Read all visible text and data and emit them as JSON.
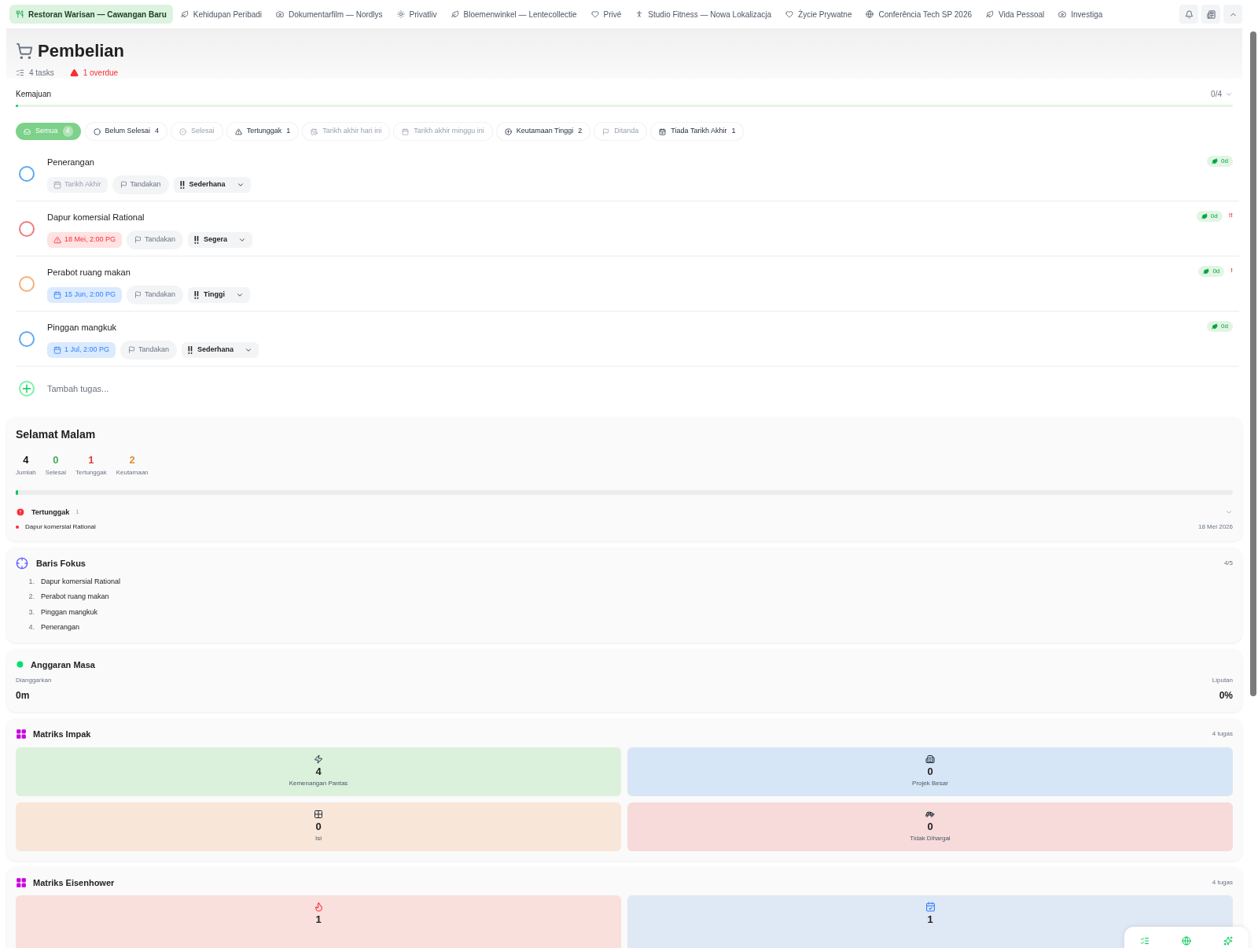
{
  "tabs": [
    {
      "label": "Restoran Warisan — Cawangan Baru",
      "selected": true
    },
    {
      "label": "Kehidupan Peribadi",
      "selected": false
    },
    {
      "label": "Dokumentarfilm — Nordlys",
      "selected": false
    },
    {
      "label": "Privatliv",
      "selected": false
    },
    {
      "label": "Bloemenwinkel — Lentecollectie",
      "selected": false
    },
    {
      "label": "Privé",
      "selected": false
    },
    {
      "label": "Studio Fitness — Nowa Lokalizacja",
      "selected": false
    },
    {
      "label": "Życie Prywatne",
      "selected": false
    },
    {
      "label": "Conferência Tech SP 2026",
      "selected": false
    },
    {
      "label": "Vida Pessoal",
      "selected": false
    },
    {
      "label": "Investiga",
      "selected": false
    }
  ],
  "header": {
    "title": "Pembelian",
    "task_count": "4 tasks",
    "overdue": "1 overdue"
  },
  "progress": {
    "label": "Kemajuan",
    "reading": "0/4",
    "level": 0
  },
  "filters": [
    {
      "label": "Semua",
      "count": "4",
      "selected": true,
      "disabled": false
    },
    {
      "label": "Belum Selesai",
      "count": "4",
      "selected": false,
      "disabled": false
    },
    {
      "label": "Selesai",
      "selected": false,
      "disabled": true
    },
    {
      "label": "Tertunggak",
      "count": "1",
      "selected": false,
      "disabled": false
    },
    {
      "label": "Tarikh akhir hari ini",
      "selected": false,
      "disabled": true
    },
    {
      "label": "Tarikh akhir minggu ini",
      "selected": false,
      "disabled": true
    },
    {
      "label": "Keutamaan Tinggi",
      "count": "2",
      "selected": false,
      "disabled": false
    },
    {
      "label": "Ditanda",
      "selected": false,
      "disabled": true
    },
    {
      "label": "Tiada Tarikh Akhir",
      "count": "1",
      "selected": false,
      "disabled": false
    }
  ],
  "tasks": [
    {
      "title": "Penerangan",
      "color": "#5fa8f0",
      "checked": false,
      "due": {
        "kind": "none",
        "text": "Tarikh Akhir"
      },
      "flag": "Tandakan",
      "priority": "Sederhana",
      "estimate": "0d"
    },
    {
      "title": "Dapur komersial Rational",
      "color": "#ef7a7a",
      "checked": false,
      "due": {
        "kind": "overdue",
        "text": "18 Mei, 2:00 PG"
      },
      "flag": "Tandakan",
      "priority": "Segera",
      "estimate": "0d",
      "priority_mark": "!!"
    },
    {
      "title": "Perabot ruang makan",
      "color": "#f4b07a",
      "checked": false,
      "due": {
        "kind": "scheduled",
        "text": "15 Jun, 2:00 PG"
      },
      "flag": "Tandakan",
      "priority": "Tinggi",
      "estimate": "0d",
      "priority_mark": "!"
    },
    {
      "title": "Pinggan mangkuk",
      "color": "#5fa8f0",
      "checked": false,
      "due": {
        "kind": "scheduled",
        "text": "1 Jul, 2:00 PG"
      },
      "flag": "Tandakan",
      "priority": "Sederhana",
      "estimate": "0d"
    }
  ],
  "add_task": {
    "placeholder": "Tambah tugas..."
  },
  "summary": {
    "title": "Selamat Malam",
    "stats": [
      {
        "value": "4",
        "label": "Jumlah",
        "color": "#111111"
      },
      {
        "value": "0",
        "label": "Selesai",
        "color": "#3fae5a"
      },
      {
        "value": "1",
        "label": "Tertunggak",
        "color": "#e03b3b"
      },
      {
        "value": "2",
        "label": "Keutamaan",
        "color": "#e08a3a"
      }
    ],
    "level": 0,
    "overdue": {
      "title": "Tertunggak",
      "count": "1",
      "expanded": true,
      "items": [
        {
          "title": "Dapur komersial Rational",
          "date": "18 Mei 2026"
        }
      ]
    }
  },
  "focus": {
    "title": "Baris Fokus",
    "reading": "4/5",
    "items": [
      {
        "number": "1.",
        "title": "Dapur komersial Rational"
      },
      {
        "number": "2.",
        "title": "Perabot ruang makan"
      },
      {
        "number": "3.",
        "title": "Pinggan mangkuk"
      },
      {
        "number": "4.",
        "title": "Penerangan"
      }
    ]
  },
  "time_budget": {
    "title": "Anggaran Masa",
    "estimated_label": "Dianggarkan",
    "estimated": "0m",
    "coverage_label": "Liputan",
    "coverage": "0%"
  },
  "impact_matrix": {
    "title": "Matriks Impak",
    "count": "4 tugas",
    "quadrants": [
      {
        "value": "4",
        "label": "Kemenangan Pantas",
        "color": "#dbf1dc"
      },
      {
        "value": "0",
        "label": "Projek Besar",
        "color": "#d6e6f6"
      },
      {
        "value": "0",
        "label": "Isi",
        "color": "#f8e6d8"
      },
      {
        "value": "0",
        "label": "Tidak Dihargai",
        "color": "#f7dada"
      }
    ]
  },
  "eisenhower_matrix": {
    "title": "Matriks Eisenhower",
    "count": "4 tugas",
    "quadrants": [
      {
        "value": "1",
        "color": "#f9e0dd"
      },
      {
        "value": "1",
        "color": "#dfe8f5"
      }
    ]
  }
}
